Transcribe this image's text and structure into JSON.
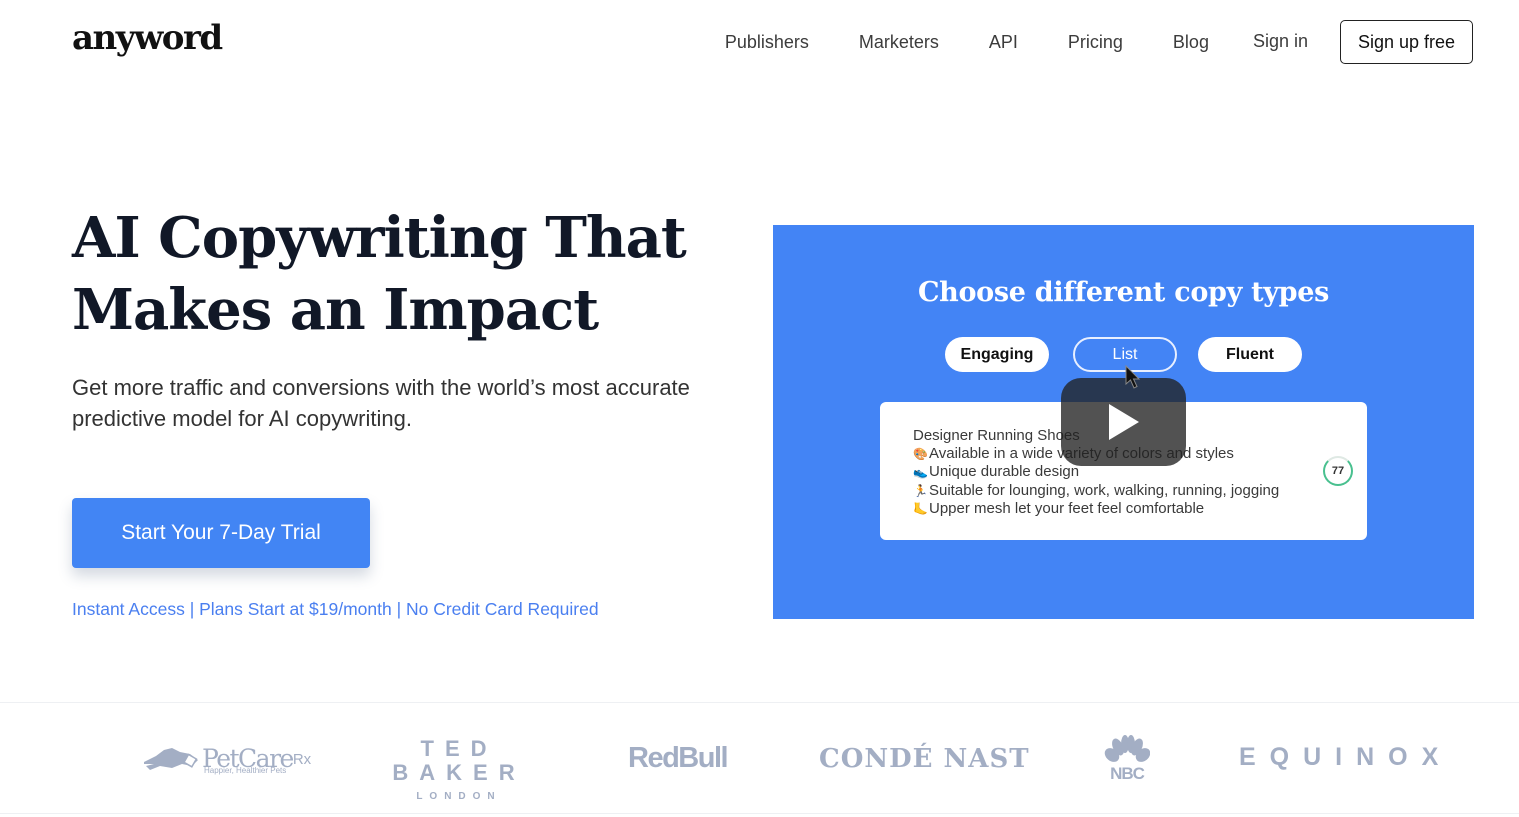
{
  "header": {
    "logo": "anyword",
    "nav": [
      {
        "label": "Publishers"
      },
      {
        "label": "Marketers"
      },
      {
        "label": "API"
      },
      {
        "label": "Pricing"
      },
      {
        "label": "Blog"
      }
    ],
    "signin_label": "Sign in",
    "signup_label": "Sign up free"
  },
  "hero": {
    "title_line1": "AI Copywriting That",
    "title_line2": "Makes an Impact",
    "subtitle": "Get more traffic and conversions with the world’s most accurate predictive model for AI copywriting.",
    "cta_label": "Start Your 7-Day Trial",
    "cta_note": "Instant Access | Plans Start at $19/month | No Credit Card Required",
    "accent_color": "#4285f4"
  },
  "video": {
    "title": "Choose different copy types",
    "copy_types": [
      {
        "label": "Engaging",
        "selected": false
      },
      {
        "label": "List",
        "selected": true
      },
      {
        "label": "Fluent",
        "selected": false
      }
    ],
    "card": {
      "heading": "Designer Running Shoes",
      "lines": [
        {
          "emoji": "🎨",
          "icon": "palette-icon",
          "text": "Available in a wide variety of colors and styles"
        },
        {
          "emoji": "👟",
          "icon": "shoe-icon",
          "text": "Unique durable design"
        },
        {
          "emoji": "🏃",
          "icon": "runner-icon",
          "text": "Suitable for lounging, work, walking, running, jogging"
        },
        {
          "emoji": "🦶",
          "icon": "foot-icon",
          "text": "Upper mesh let your feet feel comfortable"
        }
      ],
      "score": "77"
    },
    "background_color": "#4384f5"
  },
  "logos": {
    "petcare": {
      "name": "PetCare",
      "suffix": "Rx",
      "tagline": "Happier, Healthier Pets"
    },
    "tedbaker": {
      "name": "TED BAKER",
      "sub": "LONDON"
    },
    "redbull": "RedBull",
    "conde": "CONDÉ NAST",
    "nbc": "NBC",
    "equinox": "EQUINOX"
  }
}
